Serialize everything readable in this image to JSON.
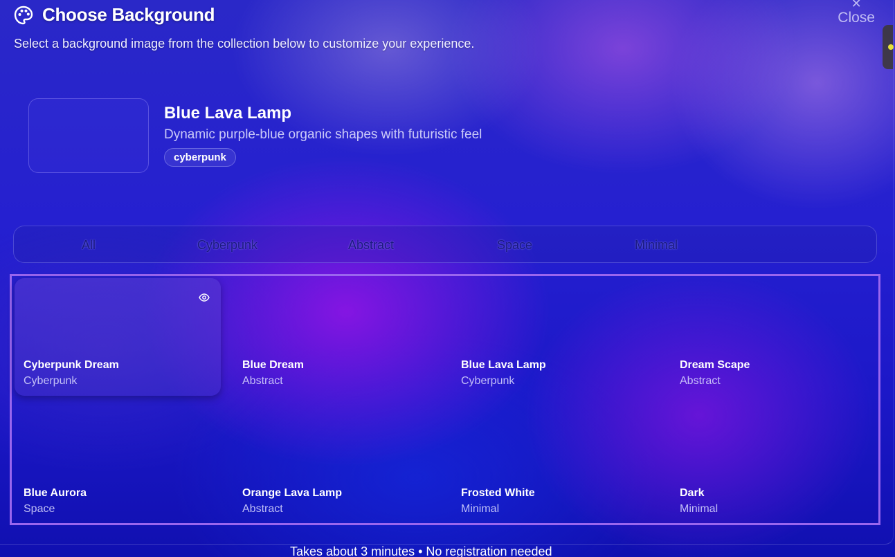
{
  "header": {
    "title": "Choose Background",
    "subtitle": "Select a background image from the collection below to customize your experience.",
    "close_label": "Close",
    "close_icon": "close-icon",
    "title_icon": "palette-icon"
  },
  "preview": {
    "title": "Blue Lava Lamp",
    "description": "Dynamic purple-blue organic shapes with futuristic feel",
    "tag": "cyberpunk"
  },
  "filters": {
    "tabs": [
      "All",
      "Cyberpunk",
      "Abstract",
      "Space",
      "Minimal"
    ]
  },
  "backgrounds": [
    {
      "name": "Cyberpunk Dream",
      "category": "Cyberpunk",
      "selected": true
    },
    {
      "name": "Blue Dream",
      "category": "Abstract"
    },
    {
      "name": "Blue Lava Lamp",
      "category": "Cyberpunk"
    },
    {
      "name": "Dream Scape",
      "category": "Abstract"
    },
    {
      "name": "Blue Aurora",
      "category": "Space"
    },
    {
      "name": "Orange Lava Lamp",
      "category": "Abstract"
    },
    {
      "name": "Frosted White",
      "category": "Minimal"
    },
    {
      "name": "Dark",
      "category": "Minimal"
    }
  ],
  "footer": {
    "note": "Takes about 3 minutes • No registration needed"
  },
  "colors": {
    "grid_border": "#9a66ee",
    "side_tab_dot": "#e6e23a"
  }
}
